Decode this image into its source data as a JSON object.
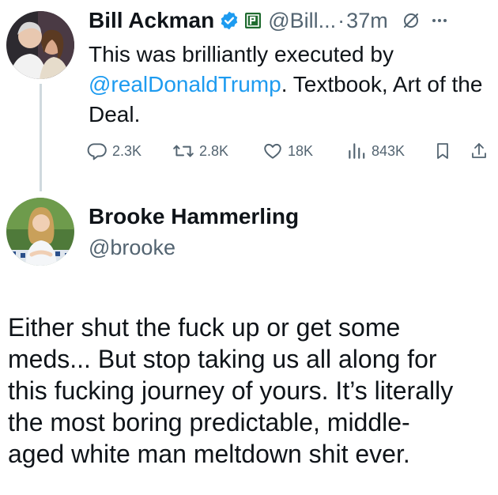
{
  "tweet": {
    "author_name": "Bill Ackman",
    "handle": "@Bill...",
    "separator": "·",
    "time": "37m",
    "text_before_mention": "This was brilliantly executed by",
    "mention": "@realDonaldTrump",
    "text_after_mention": ". Textbook, Art of the Deal.",
    "actions": {
      "replies": "2.3K",
      "reposts": "2.8K",
      "likes": "18K",
      "views": "843K"
    },
    "icons": [
      "verified-badge-icon",
      "affiliate-badge-icon",
      "grok-icon",
      "more-icon",
      "reply-icon",
      "retweet-icon",
      "like-icon",
      "views-icon",
      "bookmark-icon",
      "share-icon"
    ],
    "accent_color": "#1d9bf0"
  },
  "reply": {
    "author_name": "Brooke Hammerling",
    "handle": "@brooke",
    "body_lines": [
      "Either shut the fuck up or get some",
      "meds... But stop taking us all along for",
      "this fucking journey of yours. It’s literally",
      "the most boring predictable, middle-",
      "aged white man meltdown shit ever."
    ]
  }
}
